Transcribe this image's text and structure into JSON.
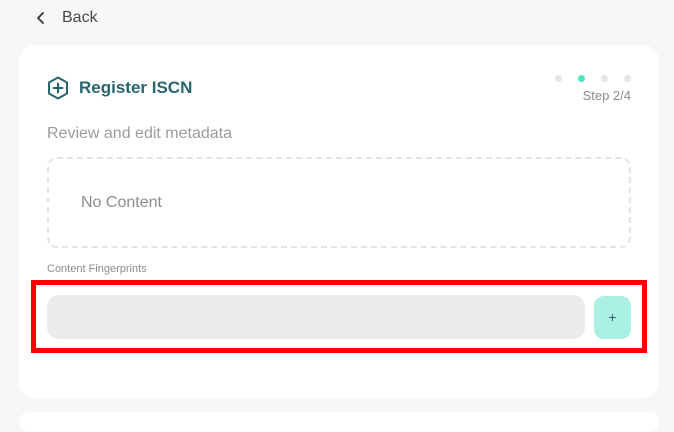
{
  "nav": {
    "back_label": "Back",
    "back_icon": "chevron-left-icon"
  },
  "card": {
    "title": "Register ISCN",
    "title_icon": "hexagon-plus-icon",
    "title_color": "#28646e",
    "stepper": {
      "total_steps": 4,
      "current_step": 2,
      "label": "Step 2/4",
      "active_color": "#50e3c2"
    },
    "subtitle": "Review and edit metadata",
    "metadata": {
      "empty_text": "No Content"
    },
    "fingerprints": {
      "label": "Content Fingerprints",
      "input_value": "",
      "input_placeholder": "",
      "add_button_label": "+",
      "add_button_color": "#aaf0e3"
    }
  },
  "highlight": {
    "color": "#ff0000"
  }
}
